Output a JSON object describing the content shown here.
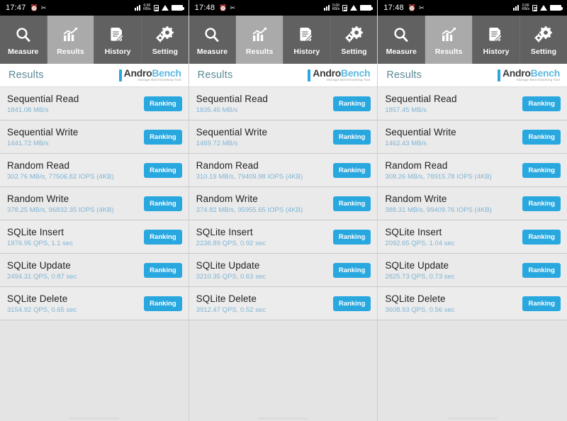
{
  "app": {
    "logo_mark": "logo-bar-icon",
    "logo_primary": "Andro",
    "logo_secondary": "Bench",
    "logo_tagline": "Storage Benchmarking Tool",
    "header_title": "Results",
    "accent_blue": "#29a8e0",
    "value_blue": "#7fb4d4",
    "tab_active_bg": "#aaaaaa",
    "tab_bg": "#616161"
  },
  "tabs": [
    {
      "label": "Measure",
      "icon": "magnifier-icon",
      "active": false
    },
    {
      "label": "Results",
      "icon": "bar-chart-icon",
      "active": true
    },
    {
      "label": "History",
      "icon": "document-pencil-icon",
      "active": false
    },
    {
      "label": "Setting",
      "icon": "gears-icon",
      "active": false
    }
  ],
  "ranking_label": "Ranking",
  "panels": [
    {
      "status": {
        "time": "17:47",
        "icons": [
          "alarm-icon",
          "scissors-icon",
          "signal-icon",
          "network-speed-icon",
          "sim-card-icon",
          "wifi-icon",
          "battery-icon"
        ]
      },
      "rows": [
        {
          "title": "Sequential Read",
          "value": "1841.08 MB/s"
        },
        {
          "title": "Sequential Write",
          "value": "1441.72 MB/s"
        },
        {
          "title": "Random Read",
          "value": "302.76 MB/s, 77506.82 IOPS (4KB)"
        },
        {
          "title": "Random Write",
          "value": "378.25 MB/s, 96832.35 IOPS (4KB)"
        },
        {
          "title": "SQLite Insert",
          "value": "1976.95 QPS, 1.1 sec"
        },
        {
          "title": "SQLite Update",
          "value": "2494.31 QPS, 0.87 sec"
        },
        {
          "title": "SQLite Delete",
          "value": "3154.92 QPS, 0.65 sec"
        }
      ]
    },
    {
      "status": {
        "time": "17:48",
        "icons": [
          "alarm-icon",
          "scissors-icon",
          "signal-icon",
          "network-speed-icon",
          "sim-card-icon",
          "wifi-icon",
          "battery-icon"
        ]
      },
      "rows": [
        {
          "title": "Sequential Read",
          "value": "1835.45 MB/s"
        },
        {
          "title": "Sequential Write",
          "value": "1469.72 MB/s"
        },
        {
          "title": "Random Read",
          "value": "310.19 MB/s, 79409.98 IOPS (4KB)"
        },
        {
          "title": "Random Write",
          "value": "374.82 MB/s, 95955.65 IOPS (4KB)"
        },
        {
          "title": "SQLite Insert",
          "value": "2236.89 QPS, 0.92 sec"
        },
        {
          "title": "SQLite Update",
          "value": "3210.35 QPS, 0.63 sec"
        },
        {
          "title": "SQLite Delete",
          "value": "3912.47 QPS, 0.52 sec"
        }
      ]
    },
    {
      "status": {
        "time": "17:48",
        "icons": [
          "alarm-icon",
          "scissors-icon",
          "signal-icon",
          "network-speed-icon",
          "sim-card-icon",
          "wifi-icon",
          "battery-icon"
        ]
      },
      "rows": [
        {
          "title": "Sequential Read",
          "value": "1857.45 MB/s"
        },
        {
          "title": "Sequential Write",
          "value": "1462.43 MB/s"
        },
        {
          "title": "Random Read",
          "value": "308.26 MB/s, 78915.78 IOPS (4KB)"
        },
        {
          "title": "Random Write",
          "value": "388.31 MB/s, 99409.76 IOPS (4KB)"
        },
        {
          "title": "SQLite Insert",
          "value": "2092.65 QPS, 1.04 sec"
        },
        {
          "title": "SQLite Update",
          "value": "2825.73 QPS, 0.73 sec"
        },
        {
          "title": "SQLite Delete",
          "value": "3608.93 QPS, 0.56 sec"
        }
      ]
    }
  ]
}
